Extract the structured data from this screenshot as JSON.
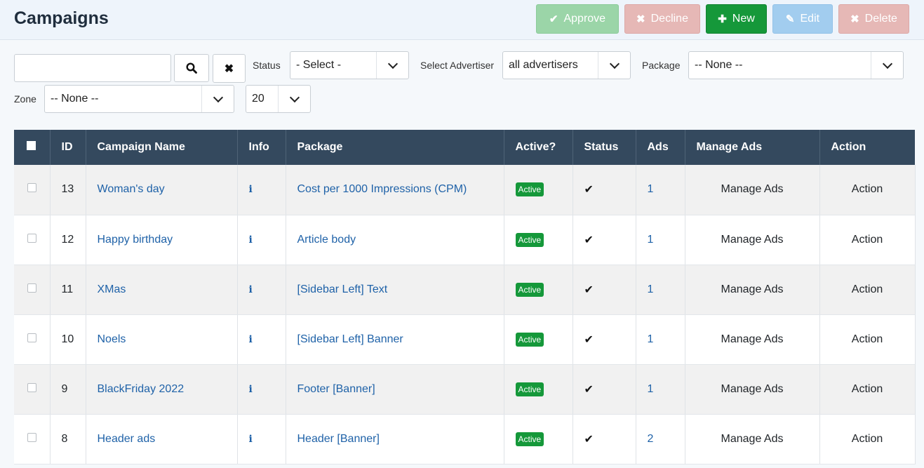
{
  "header": {
    "title": "Campaigns"
  },
  "toolbar": {
    "approve": {
      "label": "Approve",
      "icon": "check-icon"
    },
    "decline": {
      "label": "Decline",
      "icon": "x-icon"
    },
    "new": {
      "label": "New",
      "icon": "plus-icon"
    },
    "edit": {
      "label": "Edit",
      "icon": "edit-icon"
    },
    "delete": {
      "label": "Delete",
      "icon": "x-icon"
    }
  },
  "filters": {
    "search_value": "",
    "status_label": "Status",
    "status_value": "- Select -",
    "advertiser_label": "Select Advertiser",
    "advertiser_value": "all advertisers",
    "package_label": "Package",
    "package_value": "-- None --",
    "zone_label": "Zone",
    "zone_value": "-- None --",
    "limit_value": "20"
  },
  "table": {
    "columns": [
      "ID",
      "Campaign Name",
      "Info",
      "Package",
      "Active?",
      "Status",
      "Ads",
      "Manage Ads",
      "Action"
    ],
    "rows": [
      {
        "id": "13",
        "name": "Woman's day",
        "package": "Cost per 1000 Impressions (CPM)",
        "active": "Active",
        "ads": "1",
        "manage": "Manage Ads",
        "action": "Action"
      },
      {
        "id": "12",
        "name": "Happy birthday",
        "package": "Article body",
        "active": "Active",
        "ads": "1",
        "manage": "Manage Ads",
        "action": "Action"
      },
      {
        "id": "11",
        "name": "XMas",
        "package": "[Sidebar Left] Text",
        "active": "Active",
        "ads": "1",
        "manage": "Manage Ads",
        "action": "Action"
      },
      {
        "id": "10",
        "name": "Noels",
        "package": "[Sidebar Left] Banner",
        "active": "Active",
        "ads": "1",
        "manage": "Manage Ads",
        "action": "Action"
      },
      {
        "id": "9",
        "name": "BlackFriday 2022",
        "package": "Footer [Banner]",
        "active": "Active",
        "ads": "1",
        "manage": "Manage Ads",
        "action": "Action"
      },
      {
        "id": "8",
        "name": "Header ads",
        "package": "Header [Banner]",
        "active": "Active",
        "ads": "2",
        "manage": "Manage Ads",
        "action": "Action"
      }
    ]
  }
}
